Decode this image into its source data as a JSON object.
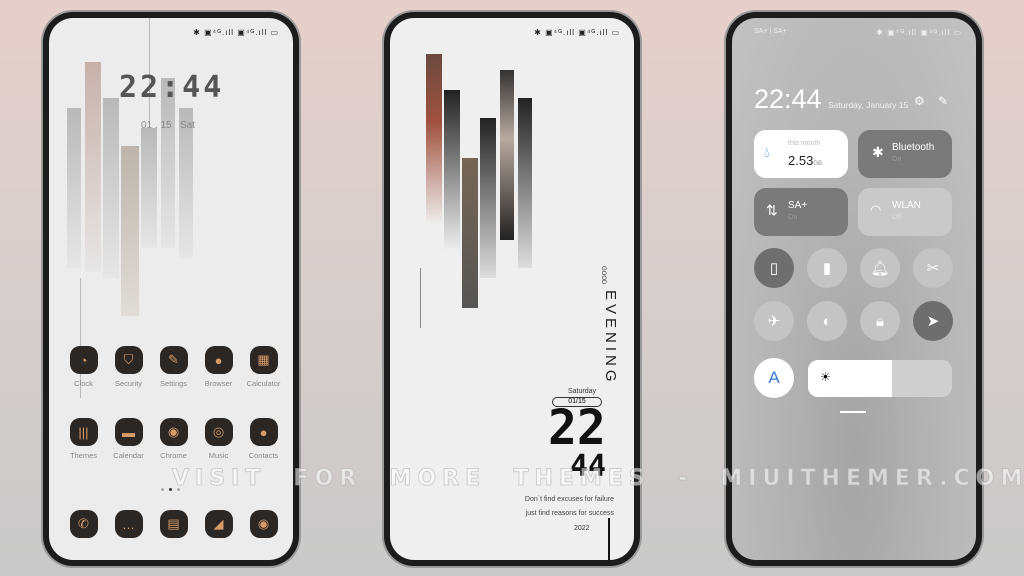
{
  "watermark": "VISIT  FOR  MORE  THEMES  -  MIUITHEMER.COM",
  "status_icons": "✱ ▣⁴ᴳ.ıll ▣⁴ᴳ.ıll ▭",
  "phone1": {
    "time": "22:44",
    "date": "01 . 15",
    "day": "Sat",
    "apps_row1": [
      {
        "label": "Clock",
        "icon": "clock-icon",
        "glyph": "◔"
      },
      {
        "label": "Security",
        "icon": "shield-icon",
        "glyph": "⛉"
      },
      {
        "label": "Settings",
        "icon": "wrench-icon",
        "glyph": "✎"
      },
      {
        "label": "Browser",
        "icon": "planet-icon",
        "glyph": "●"
      },
      {
        "label": "Calculator",
        "icon": "calculator-icon",
        "glyph": "▦"
      }
    ],
    "apps_row2": [
      {
        "label": "Themes",
        "icon": "themes-icon",
        "glyph": "|||"
      },
      {
        "label": "Calendar",
        "icon": "calendar-icon",
        "glyph": "▬"
      },
      {
        "label": "Chrome",
        "icon": "chrome-icon",
        "glyph": "◉"
      },
      {
        "label": "Music",
        "icon": "music-icon",
        "glyph": "◎"
      },
      {
        "label": "Contacts",
        "icon": "contacts-icon",
        "glyph": "●"
      }
    ],
    "dock": [
      {
        "icon": "phone-icon",
        "glyph": "✆"
      },
      {
        "icon": "messages-icon",
        "glyph": "…"
      },
      {
        "icon": "notes-icon",
        "glyph": "▤"
      },
      {
        "icon": "gallery-icon",
        "glyph": "◢"
      },
      {
        "icon": "camera-icon",
        "glyph": "◉"
      }
    ],
    "page_dots": 3,
    "active_page": 1
  },
  "phone2": {
    "greeting_small": "GOOD",
    "greeting": "EVENING",
    "day": "Saturday",
    "date": "01/15",
    "hour": "22",
    "minute": "44",
    "quote1": "Don`t find excuses for failure",
    "quote2": "just find reasons for success",
    "year": "2022"
  },
  "phone3": {
    "carrier": "SA+ | SA+",
    "time": "22:44",
    "date": "Saturday, January 15",
    "data_tile": {
      "label": "this month",
      "value": "2.53",
      "unit": "GB"
    },
    "bluetooth": {
      "label": "Bluetooth",
      "state": "On"
    },
    "mobile": {
      "label": "SA+",
      "state": "On"
    },
    "wlan": {
      "label": "WLAN",
      "state": "Off"
    },
    "brightness_percent": 58,
    "auto_brightness": "A",
    "toggles": [
      {
        "icon": "vibrate-icon",
        "glyph": "▯",
        "active": true
      },
      {
        "icon": "flashlight-icon",
        "glyph": "▮",
        "active": false
      },
      {
        "icon": "bell-icon",
        "glyph": "🔔︎",
        "active": false
      },
      {
        "icon": "screenshot-icon",
        "glyph": "✂",
        "active": false
      },
      {
        "icon": "airplane-icon",
        "glyph": "✈",
        "active": false
      },
      {
        "icon": "reading-mode-icon",
        "glyph": "◐",
        "active": false
      },
      {
        "icon": "lock-icon",
        "glyph": "🔒︎",
        "active": false
      },
      {
        "icon": "location-icon",
        "glyph": "➤",
        "active": true
      }
    ]
  }
}
